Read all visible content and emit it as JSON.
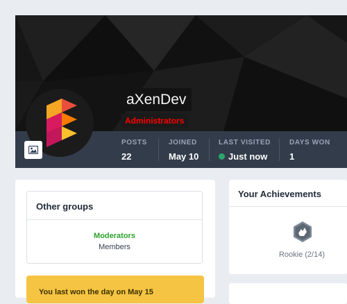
{
  "profile": {
    "username": "aXenDev",
    "group": "Administrators",
    "stats": [
      {
        "label": "POSTS",
        "value": "22"
      },
      {
        "label": "JOINED",
        "value": "May 10"
      },
      {
        "label": "LAST VISITED",
        "value": "Just now"
      },
      {
        "label": "DAYS WON",
        "value": "1"
      }
    ],
    "cover_photo_icon": "image-icon"
  },
  "other_groups": {
    "title": "Other groups",
    "primary": "Moderators",
    "secondary": "Members"
  },
  "notice": {
    "text": "You last won the day on May 15"
  },
  "achievements": {
    "title": "Your Achievements",
    "rank": "Rookie (2/14)",
    "badge_icon": "hand-badge-icon"
  },
  "colors": {
    "group": "#ff0000",
    "moderators": "#2aa32a",
    "online": "#2ea56b",
    "notice_bg": "#f6c443",
    "stats_bar": "#323c4b"
  }
}
